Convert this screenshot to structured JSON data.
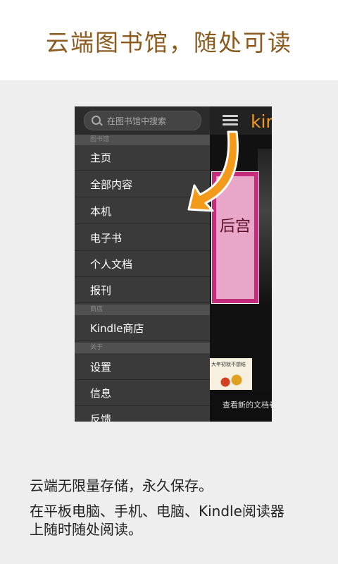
{
  "header": {
    "title": "云端图书馆，随处可读"
  },
  "drawer": {
    "search_placeholder": "在图书馆中搜索",
    "sections": {
      "library": "图书馆",
      "store": "商店",
      "about": "关于"
    },
    "library_items": [
      "主页",
      "全部内容",
      "本机",
      "电子书",
      "个人文档",
      "报刊"
    ],
    "store_items": [
      "Kindle商店"
    ],
    "about_items": [
      "设置",
      "信息",
      "反馈"
    ]
  },
  "main": {
    "logo": "kin",
    "cover1_title": "后宫",
    "cover2_caption": "大年初就不想结",
    "bottom_text": "查看新的文档卷"
  },
  "description": {
    "line1": "云端无限量存储，永久保存。",
    "line2": "在平板电脑、手机、电脑、Kindle阅读器",
    "line3": "上随时随处阅读。"
  },
  "colors": {
    "headline": "#8a5a1e",
    "accent": "#f39a1b"
  }
}
